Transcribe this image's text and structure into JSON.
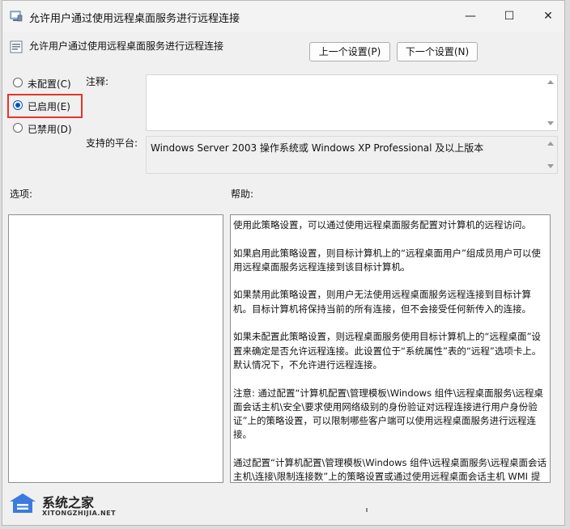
{
  "window": {
    "title": "允许用户通过使用远程桌面服务进行远程连接",
    "controls": {
      "minimize": "—",
      "maximize": "☐",
      "close": "✕"
    }
  },
  "header": {
    "title": "允许用户通过使用远程桌面服务进行远程连接",
    "prev_button": "上一个设置(P)",
    "next_button": "下一个设置(N)"
  },
  "state_options": [
    {
      "label": "未配置(C)",
      "checked": false
    },
    {
      "label": "已启用(E)",
      "checked": true
    },
    {
      "label": "已禁用(D)",
      "checked": false
    }
  ],
  "comment": {
    "label": "注释:",
    "value": ""
  },
  "platform": {
    "label": "支持的平台:",
    "value": "Windows Server 2003 操作系统或 Windows XP Professional 及以上版本"
  },
  "options": {
    "label": "选项:"
  },
  "help": {
    "label": "帮助:",
    "paragraphs": [
      "使用此策略设置，可以通过使用远程桌面服务配置对计算机的远程访问。",
      "如果启用此策略设置，则目标计算机上的“远程桌面用户”组成员用户可以使用远程桌面服务远程连接到该目标计算机。",
      "如果禁用此策略设置，则用户无法使用远程桌面服务远程连接到目标计算机。目标计算机将保持当前的所有连接，但不会接受任何新传入的连接。",
      "如果未配置此策略设置，则远程桌面服务使用目标计算机上的“远程桌面”设置来确定是否允许远程连接。此设置位于“系统属性”表的“远程”选项卡上。默认情况下，不允许进行远程连接。",
      "注意: 通过配置“计算机配置\\管理模板\\Windows 组件\\远程桌面服务\\远程桌面会话主机\\安全\\要求使用网络级别的身份验证对远程连接进行用户身份验证”上的策略设置，可以限制哪些客户端可以使用远程桌面服务进行远程连接。",
      "通过配置“计算机配置\\管理模板\\Windows 组件\\远程桌面服务\\远程桌面会话主机\\连接\\限制连接数”上的策略设置或通过使用远程桌面会话主机 WMI 提供程序配置“最大连接数”策略设置，可以限制可同时连接的用户数。"
    ]
  },
  "watermark": {
    "title": "系统之家",
    "url": "XITONGZHIJIA.NET"
  }
}
